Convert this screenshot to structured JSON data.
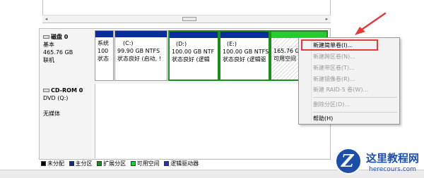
{
  "colors": {
    "primary_partition": "#0a2d9c",
    "free_space": "#24cc2e",
    "selection_border": "#1d8d1d",
    "highlight": "#e23b3b",
    "logo_blue": "#1e4fa8"
  },
  "disk0": {
    "name": "磁盘 0",
    "type": "基本",
    "size": "465.76 GB",
    "status": "联机",
    "partitions": [
      {
        "line1": "系统",
        "line2": "100",
        "line3": "状态"
      },
      {
        "line1": "(C:)",
        "line2": "99.90 GB NTFS",
        "line3": "状态良好 (启动, !"
      },
      {
        "line1": "(D:)",
        "line2": "100.00 GB NTF",
        "line3": "状态良好 (逻辑"
      },
      {
        "line1": "(E:)",
        "line2": "100.00 GB NTFS",
        "line3": "状态良好 (逻辑驱"
      },
      {
        "line1": "",
        "line2": "165.76 G",
        "line3": "可用空间"
      }
    ]
  },
  "cdrom": {
    "name": "CD-ROM 0",
    "drive": "DVD (Q:)",
    "media": "无媒体"
  },
  "context_menu": {
    "items": [
      {
        "label": "新建简单卷(I)...",
        "enabled": true
      },
      {
        "label": "新建跨区卷(N)...",
        "enabled": false
      },
      {
        "label": "新建带区卷(T)...",
        "enabled": false
      },
      {
        "label": "新建镜像卷(R)...",
        "enabled": false
      },
      {
        "label": "新建 RAID-5 卷(W)...",
        "enabled": false
      },
      {
        "label": "删除分区(D)...",
        "enabled": false
      },
      {
        "label": "帮助(H)",
        "enabled": true
      }
    ]
  },
  "legend": [
    {
      "label": "未分配",
      "color": "#000000"
    },
    {
      "label": "主分区",
      "color": "#0a2d9c"
    },
    {
      "label": "扩展分区",
      "color": "#1f8a1f"
    },
    {
      "label": "可用空间",
      "color": "#24cc2e"
    },
    {
      "label": "逻辑驱动器",
      "color": "#2a2ad8"
    }
  ],
  "watermark": {
    "cn": "这里教程网",
    "en": "herecours.com"
  }
}
